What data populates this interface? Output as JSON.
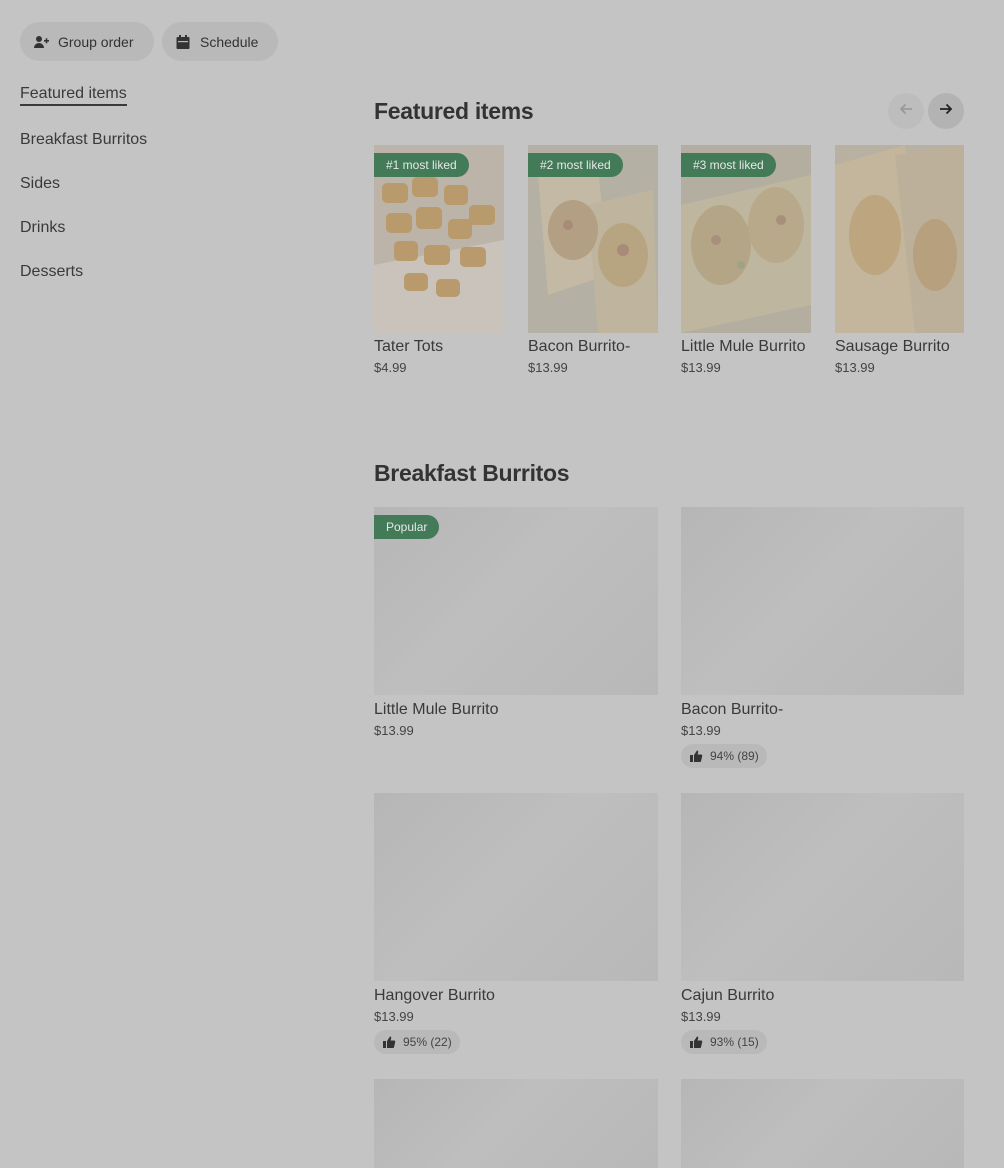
{
  "top_buttons": {
    "group_order": "Group order",
    "schedule": "Schedule"
  },
  "sidebar": {
    "items": [
      {
        "label": "Featured items"
      },
      {
        "label": "Breakfast Burritos"
      },
      {
        "label": "Sides"
      },
      {
        "label": "Drinks"
      },
      {
        "label": "Desserts"
      }
    ]
  },
  "featured": {
    "title": "Featured items",
    "items": [
      {
        "badge": "#1 most liked",
        "name": "Tater Tots",
        "price": "$4.99"
      },
      {
        "badge": "#2 most liked",
        "name": "Bacon Burrito-",
        "price": "$13.99"
      },
      {
        "badge": "#3 most liked",
        "name": "Little Mule Burrito",
        "price": "$13.99"
      },
      {
        "badge": "",
        "name": "Sausage Burrito",
        "price": "$13.99"
      }
    ]
  },
  "breakfast": {
    "title": "Breakfast Burritos",
    "items": [
      {
        "badge": "Popular",
        "name": "Little Mule Burrito",
        "price": "$13.99",
        "rating": ""
      },
      {
        "badge": "",
        "name": "Bacon Burrito-",
        "price": "$13.99",
        "rating": "94% (89)"
      },
      {
        "badge": "",
        "name": "Hangover Burrito",
        "price": "$13.99",
        "rating": "95% (22)"
      },
      {
        "badge": "",
        "name": "Cajun Burrito",
        "price": "$13.99",
        "rating": "93% (15)"
      }
    ]
  },
  "colors": {
    "background": "#c4c4c4",
    "badge_green": "#437a58"
  }
}
